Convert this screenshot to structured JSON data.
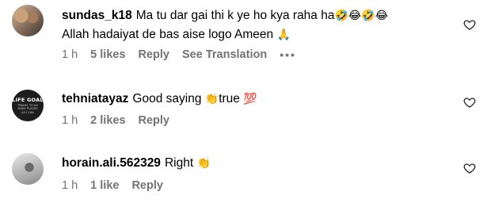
{
  "comments": [
    {
      "username": "sundas_k18",
      "text": "Ma tu dar gai thi k ye ho kya raha ha",
      "emoji1": "🤣😂🤣😂",
      "text2": "Allah hadaiyat de bas aise logo Ameen",
      "emoji2": "🙏",
      "time": "1 h",
      "likes": "5 likes",
      "reply": "Reply",
      "translate": "See Translation",
      "more": "•••"
    },
    {
      "username": "tehniatayaz",
      "avatar_line1": "LIFE GOAL",
      "avatar_line2": "TRAVEL TO AS MANY PLACES AS I CAN",
      "text": "Good saying",
      "emoji1": "👏",
      "text2": "true",
      "emoji2": "💯",
      "time": "1 h",
      "likes": "2 likes",
      "reply": "Reply"
    },
    {
      "username": "horain.ali.562329",
      "text": "Right",
      "emoji1": "👏",
      "time": "1 h",
      "likes": "1 like",
      "reply": "Reply"
    }
  ],
  "icons": {
    "like": "heart-outline-icon",
    "more": "more-horizontal-icon"
  },
  "colors": {
    "meta": "#737373",
    "text": "#000000",
    "background": "#ffffff"
  }
}
